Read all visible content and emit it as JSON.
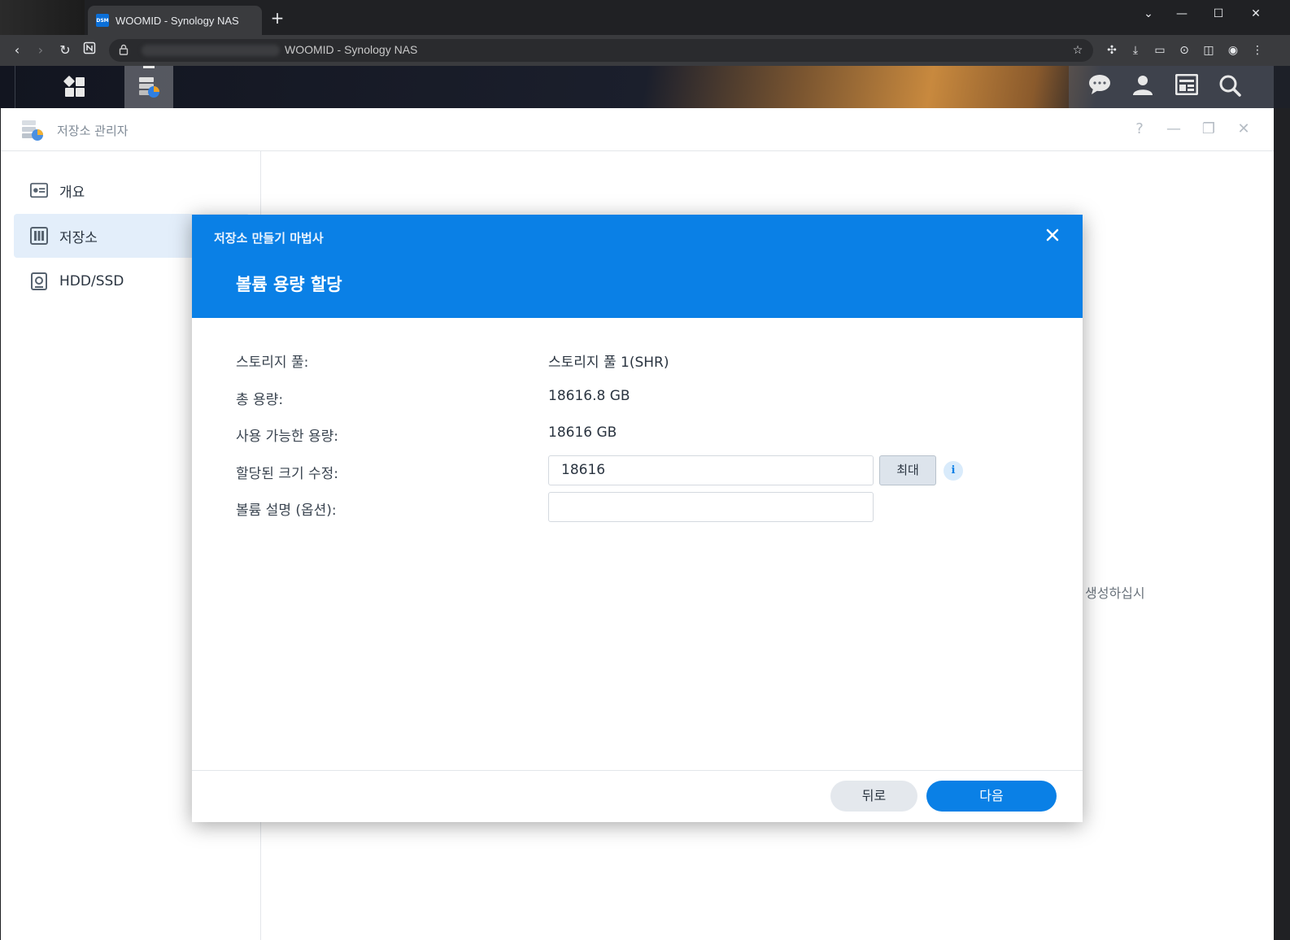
{
  "browser": {
    "tab_title": "WOOMID - Synology NAS",
    "favicon_text": "DSM",
    "new_tab": "+",
    "address_text": "WOOMID - Synology NAS",
    "window_controls": [
      "⌄",
      "—",
      "☐",
      "✕"
    ]
  },
  "dsm": {
    "taskbar_left": [
      "main-menu-icon",
      "storage-manager-icon"
    ],
    "taskbar_right": [
      "notifications-icon",
      "user-icon",
      "widgets-icon",
      "search-icon"
    ]
  },
  "window": {
    "title": "저장소 관리자",
    "controls": [
      "?",
      "—",
      "❐",
      "✕"
    ],
    "sidebar": {
      "items": [
        {
          "label": "개요",
          "icon": "overview-icon",
          "selected": false
        },
        {
          "label": "저장소",
          "icon": "storage-icon",
          "selected": true
        },
        {
          "label": "HDD/SSD",
          "icon": "hdd-icon",
          "selected": false
        }
      ]
    },
    "background_hint": "생성하십시"
  },
  "wizard": {
    "title": "저장소 만들기 마법사",
    "step_title": "볼륨 용량 할당",
    "fields": {
      "pool_label": "스토리지 풀:",
      "pool_value": "스토리지 풀 1(SHR)",
      "total_label": "총 용량:",
      "total_value": "18616.8 GB",
      "available_label": "사용 가능한 용량:",
      "available_value": "18616 GB",
      "allocated_label": "할당된 크기 수정:",
      "allocated_value": "18616",
      "max_button": "최대",
      "description_label": "볼륨 설명 (옵션):",
      "description_value": ""
    },
    "back_button": "뒤로",
    "next_button": "다음",
    "accent_color": "#0a80e6"
  }
}
